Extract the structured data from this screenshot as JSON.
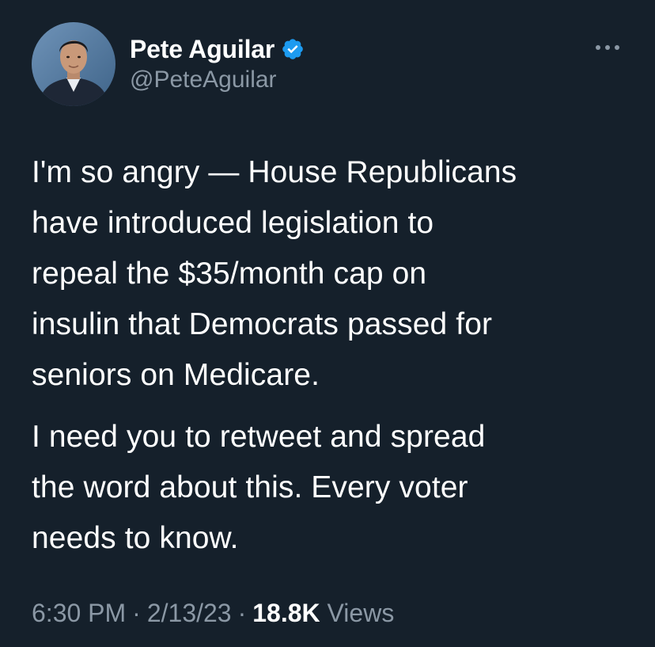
{
  "colors": {
    "background": "#15202b",
    "text_primary": "#ffffff",
    "text_secondary": "#8b98a5",
    "verified_badge": "#1d9bf0"
  },
  "author": {
    "display_name": "Pete Aguilar",
    "handle": "@PeteAguilar",
    "verified_icon": "verified-badge-icon",
    "avatar": "avatar"
  },
  "tweet": {
    "paragraphs": [
      "I'm so angry — House Republicans\nhave introduced legislation to\nrepeal the $35/month cap on\ninsulin that Democrats passed for\nseniors on Medicare.",
      "I need you to retweet and spread\nthe word about this. Every voter\nneeds to know."
    ]
  },
  "meta": {
    "time": "6:30 PM",
    "separator": "·",
    "date": "2/13/23",
    "views_count": "18.8K",
    "views_label": "Views"
  },
  "icons": {
    "more": "more-options-icon"
  }
}
